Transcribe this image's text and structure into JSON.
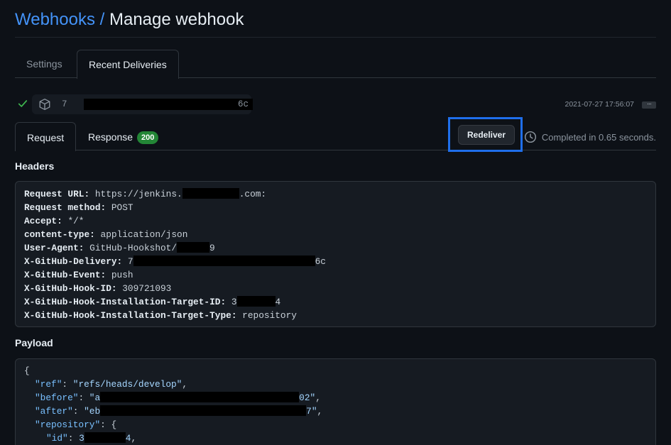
{
  "breadcrumb": {
    "link": "Webhooks",
    "sep": " / ",
    "current": "Manage webhook"
  },
  "tabs": {
    "settings": "Settings",
    "recent": "Recent Deliveries"
  },
  "delivery": {
    "guid_start": "7",
    "guid_end": "6c",
    "timestamp": "2021-07-27 17:56:07",
    "more": "···"
  },
  "subtabs": {
    "request": "Request",
    "response": "Response",
    "status": "200"
  },
  "redeliver_label": "Redeliver",
  "completed_text": "Completed in 0.65 seconds.",
  "headers_title": "Headers",
  "payload_title": "Payload",
  "headers": [
    {
      "key": "Request URL:",
      "pre": " https://jenkins.",
      "post": ".com:"
    },
    {
      "key": "Request method:",
      "pre": " POST",
      "post": ""
    },
    {
      "key": "Accept:",
      "pre": " */*",
      "post": ""
    },
    {
      "key": "content-type:",
      "pre": " application/json",
      "post": ""
    },
    {
      "key": "User-Agent:",
      "pre": " GitHub-Hookshot/",
      "post": "9"
    },
    {
      "key": "X-GitHub-Delivery:",
      "pre": " 7",
      "post": "6c"
    },
    {
      "key": "X-GitHub-Event:",
      "pre": " push",
      "post": ""
    },
    {
      "key": "X-GitHub-Hook-ID:",
      "pre": " 309721093",
      "post": ""
    },
    {
      "key": "X-GitHub-Hook-Installation-Target-ID:",
      "pre": " 3",
      "post": "4"
    },
    {
      "key": "X-GitHub-Hook-Installation-Target-Type:",
      "pre": " repository",
      "post": ""
    }
  ],
  "payload": {
    "open": "{",
    "ref_key": "\"ref\"",
    "ref_val": "\"refs/heads/develop\"",
    "before_key": "\"before\"",
    "before_pre": "\"a",
    "before_post": "02\"",
    "after_key": "\"after\"",
    "after_pre": "\"eb",
    "after_post": "7\"",
    "repo_key": "\"repository\"",
    "repo_open": "{",
    "id_key": "\"id\"",
    "id_pre": "3",
    "id_post": "4"
  }
}
